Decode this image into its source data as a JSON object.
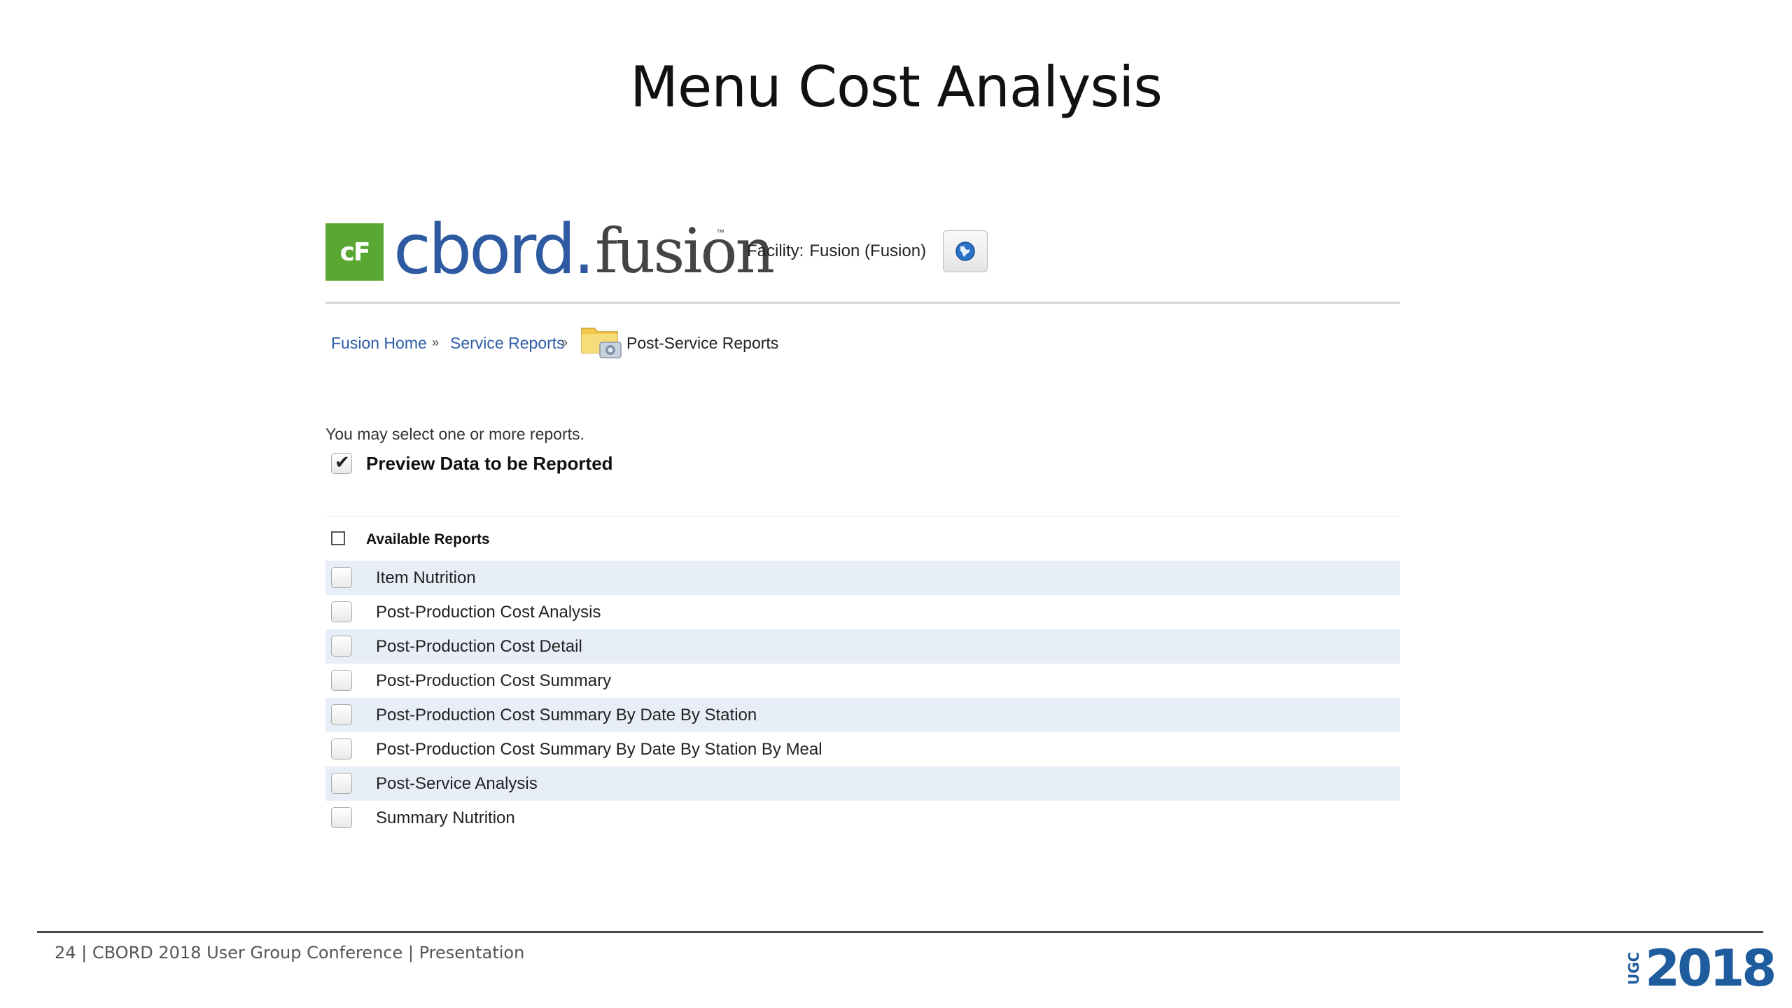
{
  "slide": {
    "title": "Menu Cost Analysis",
    "footer": "24 |  CBORD 2018 User Group Conference | Presentation",
    "logo_small": "UGC",
    "logo_year": "2018"
  },
  "app": {
    "logo_mark": "cF",
    "logo_cbord": "cbord.",
    "logo_fusion": "fusion",
    "logo_tm": "™",
    "facility_label": "Facility:",
    "facility_value": "Fusion (Fusion)",
    "globe_icon": "globe-icon"
  },
  "breadcrumb": {
    "items": [
      "Fusion Home",
      "Service Reports"
    ],
    "separator": "»",
    "current": "Post-Service Reports",
    "icon": "folder-icon"
  },
  "form": {
    "intro": "You may select one or more reports.",
    "preview_label": "Preview Data to be Reported",
    "preview_checked": true,
    "available_label": "Available Reports"
  },
  "reports": [
    "Item Nutrition",
    "Post-Production Cost Analysis",
    "Post-Production Cost Detail",
    "Post-Production Cost Summary",
    "Post-Production Cost Summary By Date By Station",
    "Post-Production Cost Summary By Date By Station By Meal",
    "Post-Service Analysis",
    "Summary Nutrition"
  ],
  "colors": {
    "accent_green": "#5aa833",
    "link_blue": "#2e5ca8",
    "row_shade": "#e8eef7",
    "ugc_blue": "#1f5c9e"
  }
}
